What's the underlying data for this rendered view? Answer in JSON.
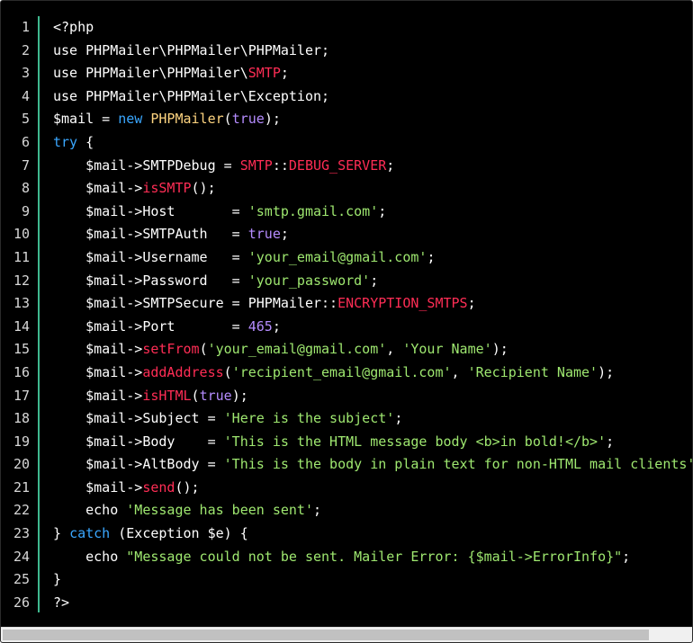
{
  "editor": {
    "language": "php",
    "line_numbers": [
      "1",
      "2",
      "3",
      "4",
      "5",
      "6",
      "7",
      "8",
      "9",
      "10",
      "11",
      "12",
      "13",
      "14",
      "15",
      "16",
      "17",
      "18",
      "19",
      "20",
      "21",
      "22",
      "23",
      "24",
      "25",
      "26"
    ],
    "lines": [
      [
        {
          "t": "<?php",
          "c": "default"
        }
      ],
      [
        {
          "t": "use PHPMailer\\PHPMailer\\PHPMailer;",
          "c": "default"
        }
      ],
      [
        {
          "t": "use PHPMailer\\PHPMailer\\",
          "c": "default"
        },
        {
          "t": "SMTP",
          "c": "const"
        },
        {
          "t": ";",
          "c": "default"
        }
      ],
      [
        {
          "t": "use PHPMailer\\PHPMailer\\Exception;",
          "c": "default"
        }
      ],
      [
        {
          "t": "$mail = ",
          "c": "default"
        },
        {
          "t": "new",
          "c": "kw"
        },
        {
          "t": " ",
          "c": "default"
        },
        {
          "t": "PHPMailer",
          "c": "cls"
        },
        {
          "t": "(",
          "c": "default"
        },
        {
          "t": "true",
          "c": "bool"
        },
        {
          "t": ");",
          "c": "default"
        }
      ],
      [
        {
          "t": "try",
          "c": "kw"
        },
        {
          "t": " {",
          "c": "default"
        }
      ],
      [
        {
          "t": "    $mail->SMTPDebug = ",
          "c": "default"
        },
        {
          "t": "SMTP",
          "c": "const"
        },
        {
          "t": "::",
          "c": "default"
        },
        {
          "t": "DEBUG_SERVER",
          "c": "const"
        },
        {
          "t": ";",
          "c": "default"
        }
      ],
      [
        {
          "t": "    $mail->",
          "c": "default"
        },
        {
          "t": "isSMTP",
          "c": "fn"
        },
        {
          "t": "();",
          "c": "default"
        }
      ],
      [
        {
          "t": "    $mail->Host       = ",
          "c": "default"
        },
        {
          "t": "'smtp.gmail.com'",
          "c": "str"
        },
        {
          "t": ";",
          "c": "default"
        }
      ],
      [
        {
          "t": "    $mail->SMTPAuth   = ",
          "c": "default"
        },
        {
          "t": "true",
          "c": "bool"
        },
        {
          "t": ";",
          "c": "default"
        }
      ],
      [
        {
          "t": "    $mail->Username   = ",
          "c": "default"
        },
        {
          "t": "'your_email@gmail.com'",
          "c": "str"
        },
        {
          "t": ";",
          "c": "default"
        }
      ],
      [
        {
          "t": "    $mail->Password   = ",
          "c": "default"
        },
        {
          "t": "'your_password'",
          "c": "str"
        },
        {
          "t": ";",
          "c": "default"
        }
      ],
      [
        {
          "t": "    $mail->SMTPSecure = PHPMailer::",
          "c": "default"
        },
        {
          "t": "ENCRYPTION_SMTPS",
          "c": "const"
        },
        {
          "t": ";",
          "c": "default"
        }
      ],
      [
        {
          "t": "    $mail->Port       = ",
          "c": "default"
        },
        {
          "t": "465",
          "c": "num"
        },
        {
          "t": ";",
          "c": "default"
        }
      ],
      [
        {
          "t": "    $mail->",
          "c": "default"
        },
        {
          "t": "setFrom",
          "c": "fn"
        },
        {
          "t": "(",
          "c": "default"
        },
        {
          "t": "'your_email@gmail.com'",
          "c": "str"
        },
        {
          "t": ", ",
          "c": "default"
        },
        {
          "t": "'Your Name'",
          "c": "str"
        },
        {
          "t": ");",
          "c": "default"
        }
      ],
      [
        {
          "t": "    $mail->",
          "c": "default"
        },
        {
          "t": "addAddress",
          "c": "fn"
        },
        {
          "t": "(",
          "c": "default"
        },
        {
          "t": "'recipient_email@gmail.com'",
          "c": "str"
        },
        {
          "t": ", ",
          "c": "default"
        },
        {
          "t": "'Recipient Name'",
          "c": "str"
        },
        {
          "t": ");",
          "c": "default"
        }
      ],
      [
        {
          "t": "    $mail->",
          "c": "default"
        },
        {
          "t": "isHTML",
          "c": "fn"
        },
        {
          "t": "(",
          "c": "default"
        },
        {
          "t": "true",
          "c": "bool"
        },
        {
          "t": ");",
          "c": "default"
        }
      ],
      [
        {
          "t": "    $mail->Subject = ",
          "c": "default"
        },
        {
          "t": "'Here is the subject'",
          "c": "str"
        },
        {
          "t": ";",
          "c": "default"
        }
      ],
      [
        {
          "t": "    $mail->Body    = ",
          "c": "default"
        },
        {
          "t": "'This is the HTML message body <b>in bold!</b>'",
          "c": "str"
        },
        {
          "t": ";",
          "c": "default"
        }
      ],
      [
        {
          "t": "    $mail->AltBody = ",
          "c": "default"
        },
        {
          "t": "'This is the body in plain text for non-HTML mail clients'",
          "c": "str"
        },
        {
          "t": ";",
          "c": "default"
        }
      ],
      [
        {
          "t": "    $mail->",
          "c": "default"
        },
        {
          "t": "send",
          "c": "fn"
        },
        {
          "t": "();",
          "c": "default"
        }
      ],
      [
        {
          "t": "    echo ",
          "c": "default"
        },
        {
          "t": "'Message has been sent'",
          "c": "str"
        },
        {
          "t": ";",
          "c": "default"
        }
      ],
      [
        {
          "t": "} ",
          "c": "default"
        },
        {
          "t": "catch",
          "c": "kw"
        },
        {
          "t": " (Exception $e) {",
          "c": "default"
        }
      ],
      [
        {
          "t": "    echo ",
          "c": "default"
        },
        {
          "t": "\"Message could not be sent. Mailer Error: {$mail->ErrorInfo}\"",
          "c": "str"
        },
        {
          "t": ";",
          "c": "default"
        }
      ],
      [
        {
          "t": "}",
          "c": "default"
        }
      ],
      [
        {
          "t": "?>",
          "c": "default"
        }
      ]
    ]
  },
  "colors": {
    "background": "#000000",
    "gutter_accent": "#3fb98f",
    "keyword": "#3aa7ff",
    "class": "#ffd580",
    "constant": "#ff2d55",
    "string": "#9fe870",
    "boolean": "#b58cff"
  },
  "scrollbar": {
    "orientation": "horizontal"
  }
}
